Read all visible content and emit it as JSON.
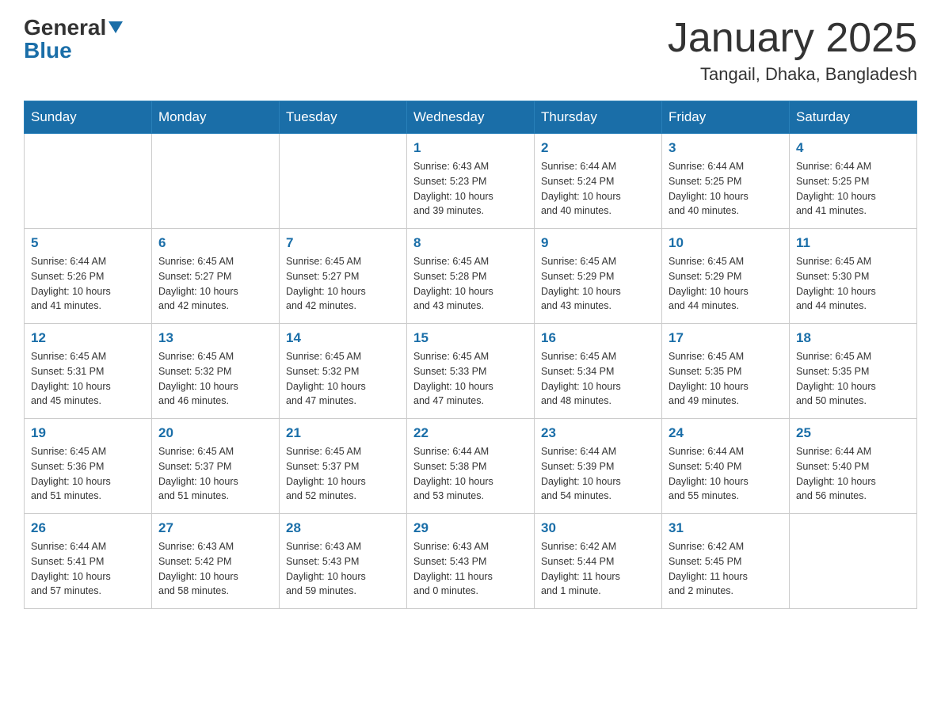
{
  "header": {
    "logo_general": "General",
    "logo_blue": "Blue",
    "title": "January 2025",
    "subtitle": "Tangail, Dhaka, Bangladesh"
  },
  "weekdays": [
    "Sunday",
    "Monday",
    "Tuesday",
    "Wednesday",
    "Thursday",
    "Friday",
    "Saturday"
  ],
  "weeks": [
    [
      {
        "day": "",
        "info": ""
      },
      {
        "day": "",
        "info": ""
      },
      {
        "day": "",
        "info": ""
      },
      {
        "day": "1",
        "info": "Sunrise: 6:43 AM\nSunset: 5:23 PM\nDaylight: 10 hours\nand 39 minutes."
      },
      {
        "day": "2",
        "info": "Sunrise: 6:44 AM\nSunset: 5:24 PM\nDaylight: 10 hours\nand 40 minutes."
      },
      {
        "day": "3",
        "info": "Sunrise: 6:44 AM\nSunset: 5:25 PM\nDaylight: 10 hours\nand 40 minutes."
      },
      {
        "day": "4",
        "info": "Sunrise: 6:44 AM\nSunset: 5:25 PM\nDaylight: 10 hours\nand 41 minutes."
      }
    ],
    [
      {
        "day": "5",
        "info": "Sunrise: 6:44 AM\nSunset: 5:26 PM\nDaylight: 10 hours\nand 41 minutes."
      },
      {
        "day": "6",
        "info": "Sunrise: 6:45 AM\nSunset: 5:27 PM\nDaylight: 10 hours\nand 42 minutes."
      },
      {
        "day": "7",
        "info": "Sunrise: 6:45 AM\nSunset: 5:27 PM\nDaylight: 10 hours\nand 42 minutes."
      },
      {
        "day": "8",
        "info": "Sunrise: 6:45 AM\nSunset: 5:28 PM\nDaylight: 10 hours\nand 43 minutes."
      },
      {
        "day": "9",
        "info": "Sunrise: 6:45 AM\nSunset: 5:29 PM\nDaylight: 10 hours\nand 43 minutes."
      },
      {
        "day": "10",
        "info": "Sunrise: 6:45 AM\nSunset: 5:29 PM\nDaylight: 10 hours\nand 44 minutes."
      },
      {
        "day": "11",
        "info": "Sunrise: 6:45 AM\nSunset: 5:30 PM\nDaylight: 10 hours\nand 44 minutes."
      }
    ],
    [
      {
        "day": "12",
        "info": "Sunrise: 6:45 AM\nSunset: 5:31 PM\nDaylight: 10 hours\nand 45 minutes."
      },
      {
        "day": "13",
        "info": "Sunrise: 6:45 AM\nSunset: 5:32 PM\nDaylight: 10 hours\nand 46 minutes."
      },
      {
        "day": "14",
        "info": "Sunrise: 6:45 AM\nSunset: 5:32 PM\nDaylight: 10 hours\nand 47 minutes."
      },
      {
        "day": "15",
        "info": "Sunrise: 6:45 AM\nSunset: 5:33 PM\nDaylight: 10 hours\nand 47 minutes."
      },
      {
        "day": "16",
        "info": "Sunrise: 6:45 AM\nSunset: 5:34 PM\nDaylight: 10 hours\nand 48 minutes."
      },
      {
        "day": "17",
        "info": "Sunrise: 6:45 AM\nSunset: 5:35 PM\nDaylight: 10 hours\nand 49 minutes."
      },
      {
        "day": "18",
        "info": "Sunrise: 6:45 AM\nSunset: 5:35 PM\nDaylight: 10 hours\nand 50 minutes."
      }
    ],
    [
      {
        "day": "19",
        "info": "Sunrise: 6:45 AM\nSunset: 5:36 PM\nDaylight: 10 hours\nand 51 minutes."
      },
      {
        "day": "20",
        "info": "Sunrise: 6:45 AM\nSunset: 5:37 PM\nDaylight: 10 hours\nand 51 minutes."
      },
      {
        "day": "21",
        "info": "Sunrise: 6:45 AM\nSunset: 5:37 PM\nDaylight: 10 hours\nand 52 minutes."
      },
      {
        "day": "22",
        "info": "Sunrise: 6:44 AM\nSunset: 5:38 PM\nDaylight: 10 hours\nand 53 minutes."
      },
      {
        "day": "23",
        "info": "Sunrise: 6:44 AM\nSunset: 5:39 PM\nDaylight: 10 hours\nand 54 minutes."
      },
      {
        "day": "24",
        "info": "Sunrise: 6:44 AM\nSunset: 5:40 PM\nDaylight: 10 hours\nand 55 minutes."
      },
      {
        "day": "25",
        "info": "Sunrise: 6:44 AM\nSunset: 5:40 PM\nDaylight: 10 hours\nand 56 minutes."
      }
    ],
    [
      {
        "day": "26",
        "info": "Sunrise: 6:44 AM\nSunset: 5:41 PM\nDaylight: 10 hours\nand 57 minutes."
      },
      {
        "day": "27",
        "info": "Sunrise: 6:43 AM\nSunset: 5:42 PM\nDaylight: 10 hours\nand 58 minutes."
      },
      {
        "day": "28",
        "info": "Sunrise: 6:43 AM\nSunset: 5:43 PM\nDaylight: 10 hours\nand 59 minutes."
      },
      {
        "day": "29",
        "info": "Sunrise: 6:43 AM\nSunset: 5:43 PM\nDaylight: 11 hours\nand 0 minutes."
      },
      {
        "day": "30",
        "info": "Sunrise: 6:42 AM\nSunset: 5:44 PM\nDaylight: 11 hours\nand 1 minute."
      },
      {
        "day": "31",
        "info": "Sunrise: 6:42 AM\nSunset: 5:45 PM\nDaylight: 11 hours\nand 2 minutes."
      },
      {
        "day": "",
        "info": ""
      }
    ]
  ]
}
